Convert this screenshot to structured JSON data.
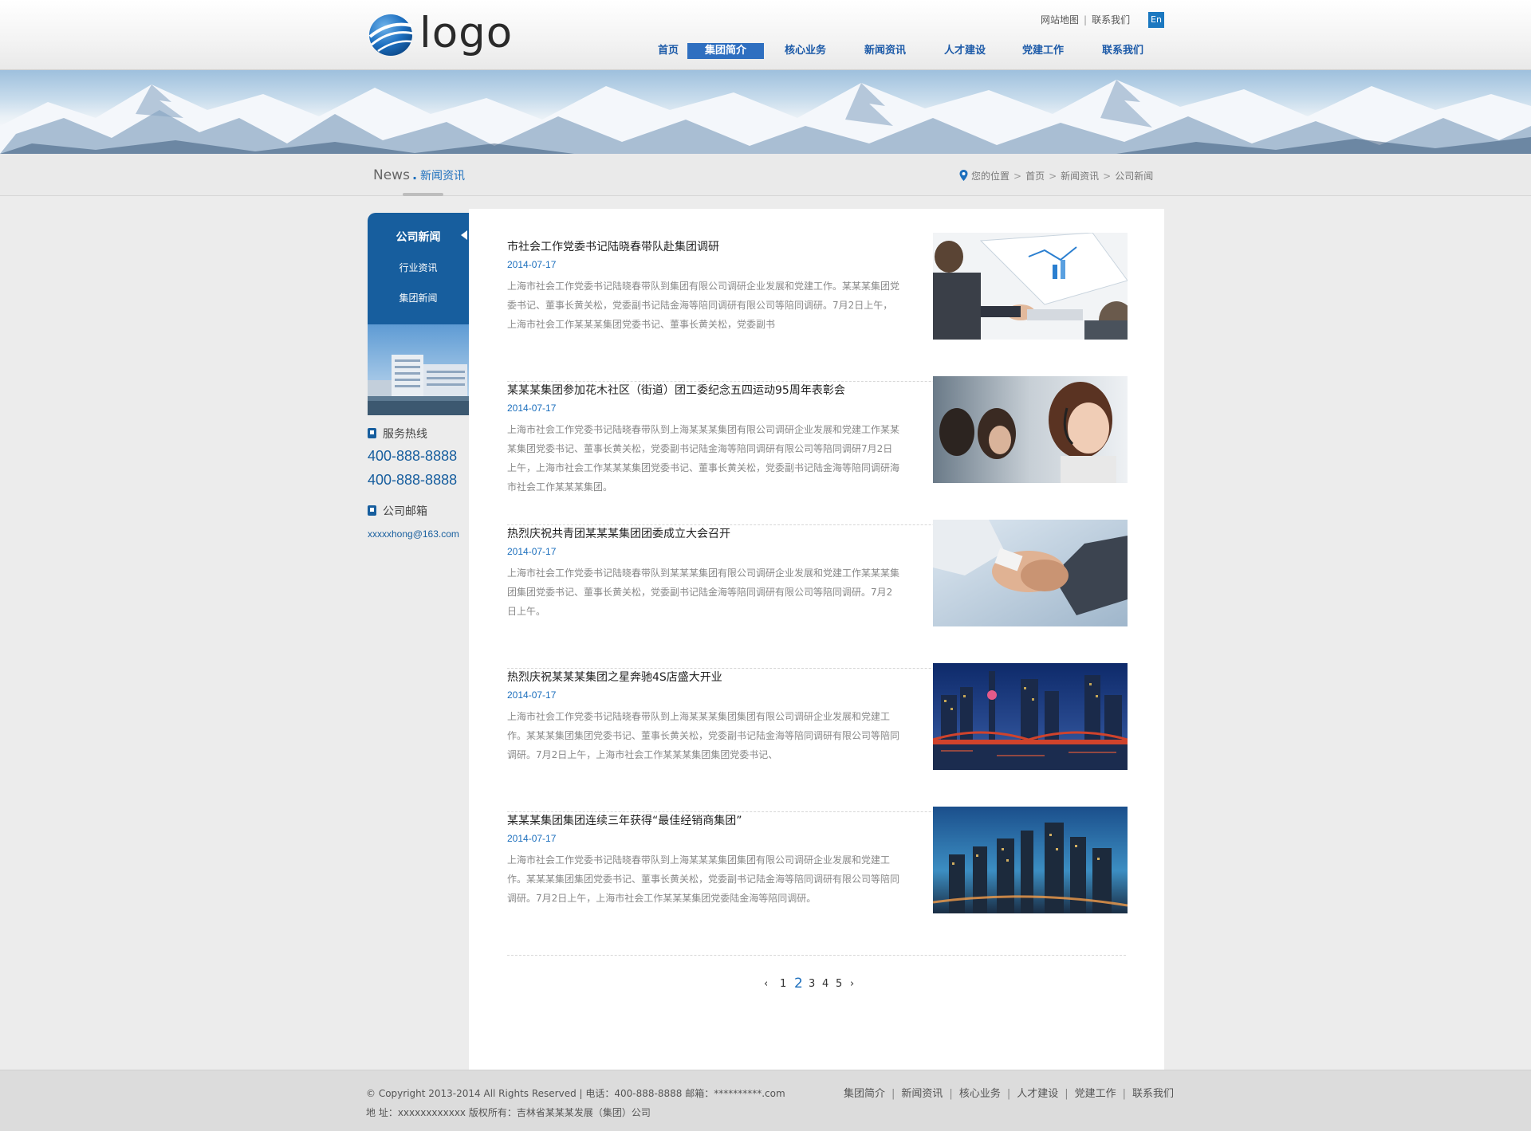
{
  "header": {
    "logo_text": "logo",
    "top_links": [
      "网站地图",
      "联系我们"
    ],
    "lang_badge": "En",
    "nav": [
      {
        "label": "首页",
        "active": false
      },
      {
        "label": "集团简介",
        "active": true
      },
      {
        "label": "核心业务",
        "active": false
      },
      {
        "label": "新闻资讯",
        "active": false
      },
      {
        "label": "人才建设",
        "active": false
      },
      {
        "label": "党建工作",
        "active": false
      },
      {
        "label": "联系我们",
        "active": false
      }
    ]
  },
  "section": {
    "title_en": "News",
    "title_cn": "新闻资讯"
  },
  "breadcrumb": [
    "您的位置",
    "首页",
    "新闻资讯",
    "公司新闻"
  ],
  "sidebar": {
    "menu": [
      {
        "label": "公司新闻",
        "active": true
      },
      {
        "label": "行业资讯",
        "active": false
      },
      {
        "label": "集团新闻",
        "active": false
      }
    ],
    "hotline_label": "服务热线",
    "phones": [
      "400-888-8888",
      "400-888-8888"
    ],
    "email_label": "公司邮箱",
    "email": "xxxxxhong@163.com"
  },
  "news": [
    {
      "title": "市社会工作党委书记陆晓春带队赴集团调研",
      "date": "2014-07-17",
      "summary": "上海市社会工作党委书记陆晓春带队到集团有限公司调研企业发展和党建工作。某某某集团党委书记、董事长黄关松，党委副书记陆金海等陪同调研有限公司等陪同调研。7月2日上午，上海市社会工作某某某集团党委书记、董事长黄关松，党委副书",
      "image": "business-meeting-photo"
    },
    {
      "title": "某某某集团参加花木社区（街道）团工委纪念五四运动95周年表彰会",
      "date": "2014-07-17",
      "summary": "上海市社会工作党委书记陆晓春带队到上海某某某集团有限公司调研企业发展和党建工作某某某集团党委书记、董事长黄关松，党委副书记陆金海等陪同调研有限公司等陪同调研7月2日上午，上海市社会工作某某某集团党委书记、董事长黄关松，党委副书记陆金海等陪同调研海市社会工作某某某集团。",
      "image": "call-center-photo"
    },
    {
      "title": "热烈庆祝共青团某某某集团团委成立大会召开",
      "date": "2014-07-17",
      "summary": "上海市社会工作党委书记陆晓春带队到某某某集团有限公司调研企业发展和党建工作某某某集团集团党委书记、董事长黄关松，党委副书记陆金海等陪同调研有限公司等陪同调研。7月2日上午。",
      "image": "handshake-photo"
    },
    {
      "title": "热烈庆祝某某某集团之星奔驰4S店盛大开业",
      "date": "2014-07-17",
      "summary": "上海市社会工作党委书记陆晓春带队到上海某某某集团集团有限公司调研企业发展和党建工作。某某某集团集团党委书记、董事长黄关松，党委副书记陆金海等陪同调研有限公司等陪同调研。7月2日上午，上海市社会工作某某某集团集团党委书记、",
      "image": "city-night-bridge-photo"
    },
    {
      "title": "某某某集团集团连续三年获得“最佳经销商集团”",
      "date": "2014-07-17",
      "summary": "上海市社会工作党委书记陆晓春带队到上海某某某集团集团有限公司调研企业发展和党建工作。某某某集团集团党委书记、董事长黄关松，党委副书记陆金海等陪同调研有限公司等陪同调研。7月2日上午，上海市社会工作某某某集团党委陆金海等陪同调研。",
      "image": "city-skyline-photo"
    }
  ],
  "pager": {
    "prev": "‹",
    "pages": [
      "1",
      "2",
      "3",
      "4",
      "5"
    ],
    "current": "2",
    "next": "›"
  },
  "footer": {
    "line1": "© Copyright 2013-2014 All Rights Reserved | 电话：400-888-8888 邮箱：**********.com",
    "line2": "地 址：xxxxxxxxxxxx   版权所有：吉林省某某某发展（集团）公司",
    "links": [
      "集团简介",
      "新闻资讯",
      "核心业务",
      "人才建设",
      "党建工作",
      "联系我们"
    ]
  },
  "colors": {
    "brand_blue": "#175e9e",
    "link_blue": "#1c6fbd",
    "nav_active": "#2f6fc0"
  }
}
